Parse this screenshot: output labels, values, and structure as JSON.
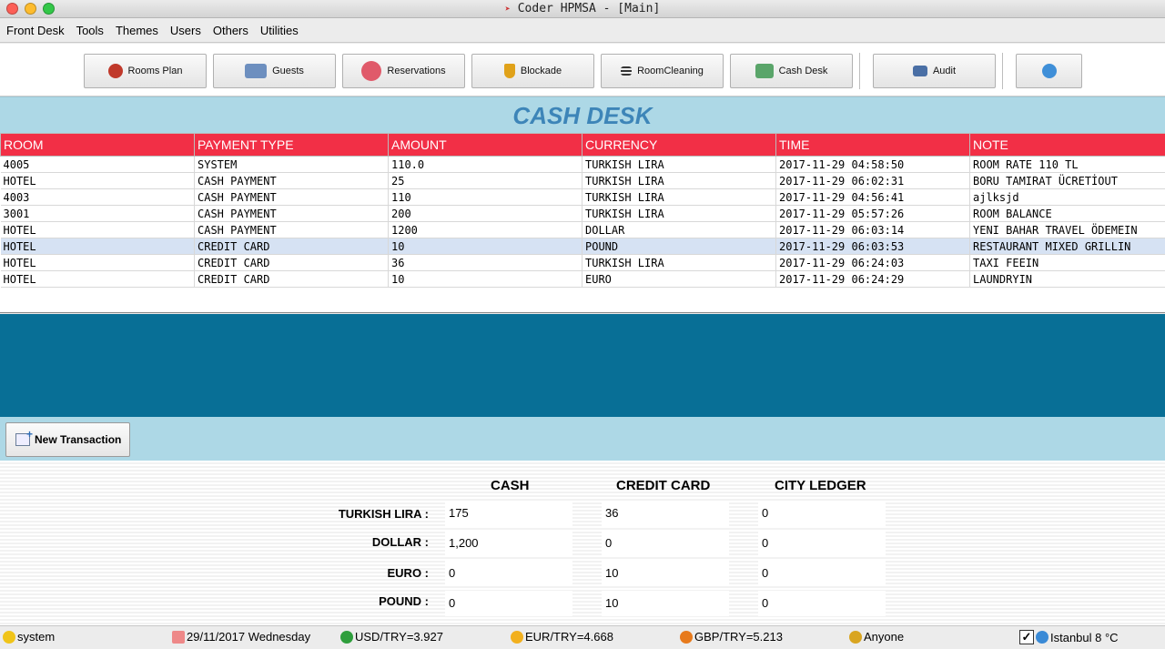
{
  "window": {
    "title": "Coder HPMSA - [Main]"
  },
  "menu": [
    "Front Desk",
    "Tools",
    "Themes",
    "Users",
    "Others",
    "Utilities"
  ],
  "toolbar": {
    "rooms_plan": "Rooms Plan",
    "guests": "Guests",
    "reservations": "Reservations",
    "blockade": "Blockade",
    "room_cleaning": "RoomCleaning",
    "cash_desk": "Cash Desk",
    "audit": "Audit"
  },
  "page": {
    "title": "CASH DESK"
  },
  "table": {
    "columns": [
      "ROOM",
      "PAYMENT TYPE",
      "AMOUNT",
      "CURRENCY",
      "TIME",
      "NOTE"
    ],
    "rows": [
      [
        "4005",
        "SYSTEM",
        "110.0",
        "TURKISH LIRA",
        "2017-11-29 04:58:50",
        "ROOM RATE 110 TL"
      ],
      [
        "HOTEL",
        "CASH PAYMENT",
        "25",
        "TURKISH LIRA",
        "2017-11-29 06:02:31",
        "BORU TAMIRAT ÜCRETİOUT"
      ],
      [
        "4003",
        "CASH PAYMENT",
        "110",
        "TURKISH LIRA",
        "2017-11-29 04:56:41",
        "ajlksjd"
      ],
      [
        "3001",
        "CASH PAYMENT",
        "200",
        "TURKISH LIRA",
        "2017-11-29 05:57:26",
        "ROOM BALANCE"
      ],
      [
        "HOTEL",
        "CASH PAYMENT",
        "1200",
        "DOLLAR",
        "2017-11-29 06:03:14",
        "YENI BAHAR TRAVEL ÖDEMEIN"
      ],
      [
        "HOTEL",
        "CREDIT CARD",
        "10",
        "POUND",
        "2017-11-29 06:03:53",
        "RESTAURANT MIXED GRILLIN"
      ],
      [
        "HOTEL",
        "CREDIT CARD",
        "36",
        "TURKISH LIRA",
        "2017-11-29 06:24:03",
        "TAXI FEEIN"
      ],
      [
        "HOTEL",
        "CREDIT CARD",
        "10",
        "EURO",
        "2017-11-29 06:24:29",
        "LAUNDRYIN"
      ]
    ]
  },
  "actions": {
    "new_transaction": "New Transaction"
  },
  "summary": {
    "columns": [
      "CASH",
      "CREDIT CARD",
      "CITY LEDGER"
    ],
    "rows": [
      {
        "label": "TURKISH LIRA :",
        "values": [
          "175",
          "36",
          "0"
        ]
      },
      {
        "label": "DOLLAR :",
        "values": [
          "1,200",
          "0",
          "0"
        ]
      },
      {
        "label": "EURO :",
        "values": [
          "0",
          "10",
          "0"
        ]
      },
      {
        "label": "POUND :",
        "values": [
          "0",
          "10",
          "0"
        ]
      }
    ]
  },
  "status": {
    "user": "system",
    "date": "29/11/2017 Wednesday",
    "usd": "USD/TRY=3.927",
    "eur": "EUR/TRY=4.668",
    "gbp": "GBP/TRY=5.213",
    "anyone": "Anyone",
    "weather": "Istanbul 8 °C"
  },
  "colors": {
    "header_red": "#f22f46",
    "band_blue": "#086f96",
    "light_blue": "#add8e6",
    "title_blue": "#3d85b8"
  }
}
